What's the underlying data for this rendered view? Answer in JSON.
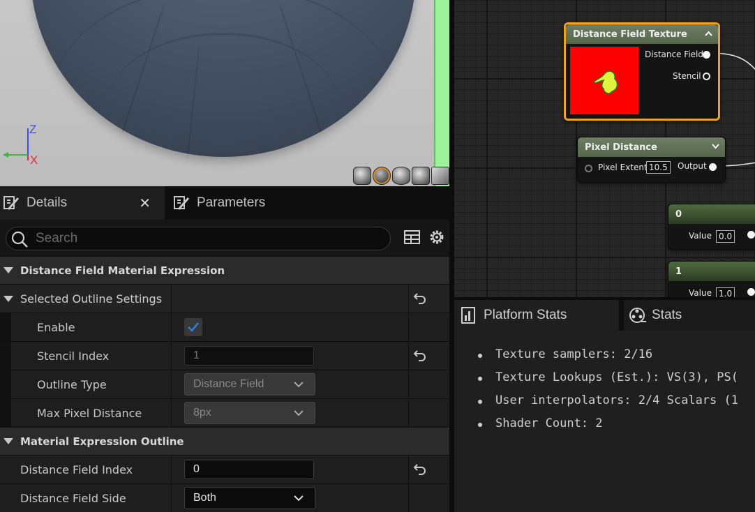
{
  "viewport": {
    "axes": {
      "z": "Z",
      "x": "X"
    },
    "view_buttons": [
      "cylinder-preview",
      "sphere-preview",
      "plane-preview",
      "cube-preview",
      "custom-mesh-preview"
    ]
  },
  "details_panel": {
    "tabs": [
      {
        "label": "Details",
        "icon": "pencil-icon",
        "closable": true
      },
      {
        "label": "Parameters",
        "icon": "pencil-icon"
      }
    ],
    "search": {
      "placeholder": "Search",
      "value": ""
    },
    "categories": [
      {
        "title": "Distance Field Material Expression",
        "subgroup": {
          "title": "Selected Outline Settings",
          "rows": [
            {
              "label": "Enable",
              "type": "checkbox",
              "checked": true
            },
            {
              "label": "Stencil Index",
              "type": "number",
              "value": "1"
            },
            {
              "label": "Outline Type",
              "type": "dropdown",
              "value": "Distance Field"
            },
            {
              "label": "Max Pixel Distance",
              "type": "dropdown",
              "value": "8px"
            }
          ]
        }
      },
      {
        "title": "Material Expression Outline",
        "rows": [
          {
            "label": "Distance Field Index",
            "type": "number",
            "value": "0"
          },
          {
            "label": "Distance Field Side",
            "type": "dropdown",
            "value": "Both"
          }
        ]
      }
    ]
  },
  "graph": {
    "nodes": {
      "distance_field_texture": {
        "title": "Distance Field Texture",
        "outputs": [
          "Distance Field",
          "Stencil"
        ],
        "preview_color": "#ff0000"
      },
      "pixel_distance": {
        "title": "Pixel Distance",
        "input_label": "Pixel Extent",
        "input_value": "10.5",
        "output_label": "Output"
      },
      "constant_0": {
        "title": "0",
        "value_label": "Value",
        "value": "0.0"
      },
      "constant_1": {
        "title": "1",
        "value_label": "Value",
        "value": "1.0"
      }
    }
  },
  "stats_panel": {
    "tabs": [
      {
        "label": "Platform Stats",
        "icon": "chart-icon"
      },
      {
        "label": "Stats",
        "icon": "film-reel-icon"
      }
    ],
    "lines": [
      "Texture samplers: 2/16",
      "Texture Lookups (Est.): VS(3), PS(",
      "User interpolators: 2/4 Scalars (1",
      "Shader Count: 2"
    ]
  },
  "colors": {
    "accent_orange": "#f2a11b",
    "node_header": "#5d6e52",
    "checkbox_check": "#2f7fd8"
  }
}
